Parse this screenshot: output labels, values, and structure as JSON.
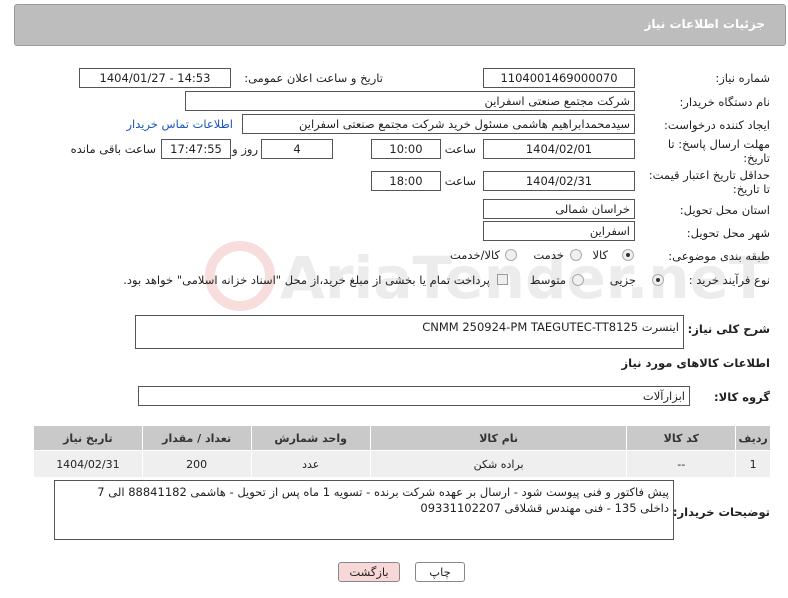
{
  "header": {
    "title": "جزئیات اطلاعات نیاز"
  },
  "fields": {
    "need_number_label": "شماره نیاز:",
    "need_number": "1104001469000070",
    "announce_label": "تاریخ و ساعت اعلان عمومی:",
    "announce_value": "1404/01/27 - 14:53",
    "buyer_label": "نام دستگاه خریدار:",
    "buyer_value": "شرکت مجتمع صنعتی اسفراین",
    "creator_label": "ایجاد کننده درخواست:",
    "creator_value": "سیدمحمدابراهیم هاشمی مسئول خرید شرکت مجتمع صنعتی اسفراین",
    "contact_link": "اطلاعات تماس خریدار",
    "deadline_label_1": "مهلت ارسال پاسخ: تا",
    "deadline_label_2": "تاریخ:",
    "deadline_date": "1404/02/01",
    "time_label": "ساعت",
    "deadline_time": "10:00",
    "days_value": "4",
    "days_label": "روز و",
    "remaining_time": "17:47:55",
    "remaining_label": "ساعت باقی مانده",
    "min_valid_label_1": "حداقل تاریخ اعتبار قیمت:",
    "min_valid_label_2": "تا تاریخ:",
    "valid_date": "1404/02/31",
    "valid_time": "18:00",
    "province_label": "استان محل تحویل:",
    "province_value": "خراسان شمالی",
    "city_label": "شهر محل تحویل:",
    "city_value": "اسفراین",
    "category_label": "طبقه بندی موضوعی:",
    "category_options": [
      "کالا",
      "خدمت",
      "کالا/خدمت"
    ],
    "process_label": "نوع فرآیند خرید :",
    "process_options": [
      "جزیی",
      "متوسط"
    ],
    "payment_note": "پرداخت تمام یا بخشی از مبلغ خرید،از محل \"اسناد خزانه اسلامی\" خواهد بود."
  },
  "description": {
    "label": "شرح کلی نیاز:",
    "value": "اینسرت CNMM 250924-PM TAEGUTEC-TT8125"
  },
  "goods_section": {
    "title": "اطلاعات کالاهای مورد نیاز",
    "group_label": "گروه کالا:",
    "group_value": "ابزارآلات"
  },
  "table": {
    "headers": [
      "ردیف",
      "کد کالا",
      "نام کالا",
      "واحد شمارش",
      "تعداد / مقدار",
      "تاریخ نیاز"
    ],
    "rows": [
      [
        "1",
        "--",
        "براده شکن",
        "عدد",
        "200",
        "1404/02/31"
      ]
    ]
  },
  "buyer_notes": {
    "label": "توضیحات خریدار:",
    "line1": "پیش فاکتور و فنی پیوست شود - ارسال بر عهده شرکت برنده - تسویه 1 ماه پس از تحویل - هاشمی 88841182 الی 7",
    "line2": "داخلی 135 - فنی مهندس قشلاقی 09331102207"
  },
  "buttons": {
    "print": "چاپ",
    "back": "بازگشت"
  },
  "watermark": "AriaTender.neT",
  "colors": {
    "header_bg": "#bdbdbd",
    "table_header": "#c9c9c9",
    "link": "#1a55c0",
    "back_button": "#f7d7d7"
  }
}
